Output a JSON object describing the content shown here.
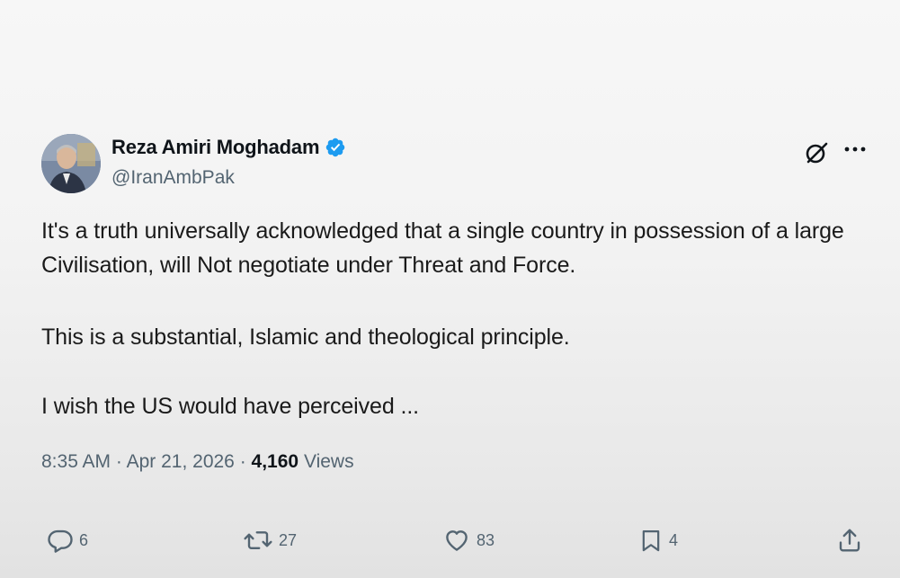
{
  "author": {
    "display_name": "Reza Amiri Moghadam",
    "handle": "@IranAmbPak",
    "verified": true,
    "avatar_icon": "profile-photo"
  },
  "header_icons": {
    "grok": "grok-icon",
    "more": "more-icon"
  },
  "tweet": {
    "paragraphs": [
      "It's a truth universally acknowledged that a single country in possession of a large Civilisation, will Not negotiate under Threat and Force.",
      "This is a substantial, Islamic and theological principle.",
      "I wish the US would have perceived ..."
    ]
  },
  "meta": {
    "time": "8:35 AM",
    "date": "Apr 21, 2026",
    "separator": "·",
    "views_count": "4,160",
    "views_label": "Views"
  },
  "actions": {
    "replies": "6",
    "reposts": "27",
    "likes": "83",
    "bookmarks": "4"
  },
  "colors": {
    "verified": "#1d9bf0",
    "secondary_text": "#536471",
    "primary_text": "#0f1419"
  }
}
